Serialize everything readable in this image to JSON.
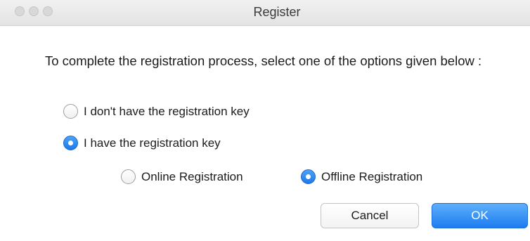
{
  "window": {
    "title": "Register"
  },
  "instruction": "To complete the registration process, select one of the options given below :",
  "options": {
    "no_key": {
      "label": "I don't have the registration key",
      "selected": false
    },
    "have_key": {
      "label": "I have the registration key",
      "selected": true
    }
  },
  "sub_options": {
    "online": {
      "label": "Online Registration",
      "selected": false
    },
    "offline": {
      "label": "Offline Registration",
      "selected": true
    }
  },
  "buttons": {
    "cancel": "Cancel",
    "ok": "OK"
  },
  "colors": {
    "accent": "#1f78e8",
    "titlebar": "#e8e8e8"
  }
}
